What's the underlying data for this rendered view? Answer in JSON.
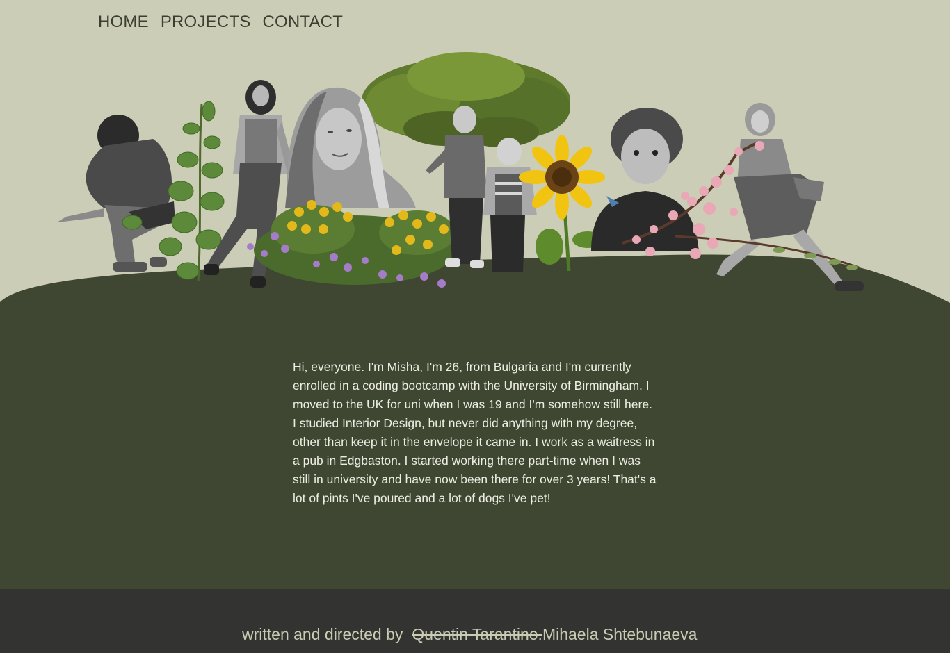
{
  "nav": {
    "items": [
      {
        "label": "HOME"
      },
      {
        "label": "PROJECTS"
      },
      {
        "label": "CONTACT"
      }
    ]
  },
  "bio": {
    "text": "Hi, everyone. I'm Misha, I'm 26, from Bulgaria and I'm currently enrolled in a coding bootcamp with the University of Birmingham. I moved to the UK for uni when I was 19 and I'm somehow still here. I studied Interior Design, but never did anything with my degree, other than keep it in the envelope it came in. I work as a waitress in a pub in Edgbaston. I started working there part-time when I was still in university and have now been there for over 3 years! That's a lot of pints I've poured and a lot of dogs I've pet!"
  },
  "footer": {
    "prefix": "written and directed by",
    "struck_name": "Quentin Tarantino.",
    "name": "Mihaela Shtebunaeva"
  },
  "colors": {
    "page_bg": "#cccdb6",
    "hill": "#3f4733",
    "footer_bg": "#333431",
    "bio_text": "#eceee2",
    "nav_text": "#3a3f2f",
    "footer_text": "#c9cbb3"
  },
  "collage": {
    "items": [
      "crouching-woman-photo",
      "eucalyptus-plant",
      "standing-woman-photo",
      "portrait-woman-photo",
      "wildflower-bush",
      "oak-tree",
      "two-boys-photo",
      "sunflower",
      "child-portrait-photo",
      "cherry-blossom-branch",
      "lunging-woman-photo"
    ]
  }
}
